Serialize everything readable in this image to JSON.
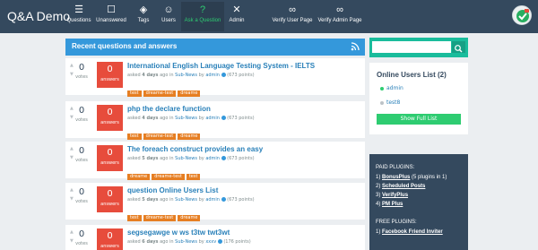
{
  "nav": {
    "brand": "Q&A Demo",
    "items": [
      {
        "label": "Questions",
        "icon": "☰"
      },
      {
        "label": "Unanswered",
        "icon": "☐"
      },
      {
        "label": "Tags",
        "icon": "◈"
      },
      {
        "label": "Users",
        "icon": "☺"
      },
      {
        "label": "Ask a Question",
        "icon": "?"
      },
      {
        "label": "Admin",
        "icon": "✕"
      },
      {
        "label": "Verify User Page",
        "icon": "∞"
      },
      {
        "label": "Verify Admin Page",
        "icon": "∞"
      }
    ]
  },
  "main": {
    "title": "Recent questions and answers",
    "votes_label": "votes",
    "answers_label": "answers",
    "questions": [
      {
        "votes": "0",
        "answers": "0",
        "title": "International English Language Testing System - IELTS",
        "meta": {
          "asked": "asked",
          "when": "4 days",
          "ago": "ago in",
          "category": "Sub-News",
          "by": "by",
          "user": "admin",
          "points": "(673 points)"
        },
        "tags": [
          "test",
          "dreame-test",
          "dreame"
        ]
      },
      {
        "votes": "0",
        "answers": "0",
        "title": "php the declare function",
        "meta": {
          "asked": "asked",
          "when": "4 days",
          "ago": "ago in",
          "category": "Sub-News",
          "by": "by",
          "user": "admin",
          "points": "(673 points)"
        },
        "tags": [
          "test",
          "dreame-test",
          "dreame"
        ]
      },
      {
        "votes": "0",
        "answers": "0",
        "title": "The foreach construct provides an easy",
        "meta": {
          "asked": "asked",
          "when": "5 days",
          "ago": "ago in",
          "category": "Sub-News",
          "by": "by",
          "user": "admin",
          "points": "(673 points)"
        },
        "tags": [
          "dreame",
          "dreame-test",
          "test"
        ]
      },
      {
        "votes": "0",
        "answers": "0",
        "title": "question Online Users List",
        "meta": {
          "asked": "asked",
          "when": "5 days",
          "ago": "ago in",
          "category": "Sub-News",
          "by": "by",
          "user": "admin",
          "points": "(673 points)"
        },
        "tags": [
          "test",
          "dreame-test",
          "dreame"
        ]
      },
      {
        "votes": "0",
        "answers": "0",
        "title": "segsegawge w ws t3tw twt3wt",
        "meta": {
          "asked": "asked",
          "when": "6 days",
          "ago": "ago in",
          "category": "Sub-News",
          "by": "by",
          "user": "xxxv",
          "points": "(176 points)"
        },
        "tags": []
      }
    ]
  },
  "sidebar": {
    "search_placeholder": "",
    "online_title": "Online Users List (2)",
    "online_users": [
      "admin",
      "test8"
    ],
    "full_list_label": "Show Full List",
    "paid_heading": "PAID PLUGINS:",
    "paid": [
      {
        "num": "1)",
        "name": "BonusPlus",
        "extra": " (5 plugins in 1)"
      },
      {
        "num": "2)",
        "name": "Scheduled Posts",
        "extra": ""
      },
      {
        "num": "3)",
        "name": "VerifyPlus",
        "extra": ""
      },
      {
        "num": "4)",
        "name": "PM Plus",
        "extra": ""
      }
    ],
    "free_heading": "FREE PLUGINS:",
    "free": [
      {
        "num": "1)",
        "name": "Facebook Friend Inviter",
        "extra": ""
      }
    ]
  },
  "colors": {
    "navbar": "#34495e",
    "accent_blue": "#3498db",
    "answers_red": "#e74c3c",
    "tag_orange": "#e67e22",
    "online_green": "#2ecc71",
    "search_teal": "#1abc9c"
  }
}
